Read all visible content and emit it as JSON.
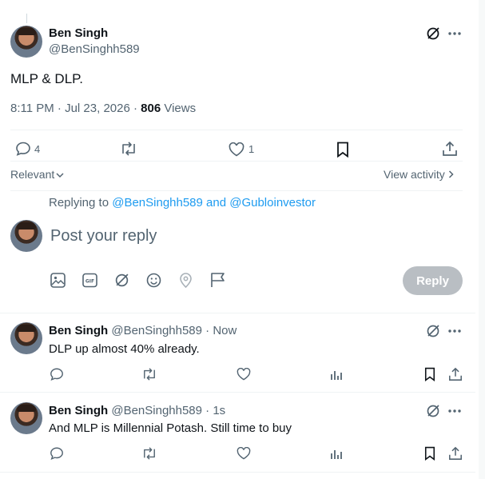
{
  "main_post": {
    "author_name": "Ben Singh",
    "author_handle": "@BenSinghh589",
    "text": "MLP & DLP.",
    "time": "8:11 PM · Jul 23, 2026 ·",
    "views_count": "806",
    "views_label": "Views",
    "reply_count": "4",
    "like_count": "1"
  },
  "filters": {
    "sort_label": "Relevant",
    "view_activity_label": "View activity"
  },
  "composer": {
    "replying_to_prefix": "Replying to",
    "replying_to_users": "@BenSinghh589 and @Gubloinvestor",
    "placeholder": "Post your reply",
    "reply_button": "Reply"
  },
  "replies": [
    {
      "author_name": "Ben Singh",
      "meta": "@BenSinghh589 · Now",
      "text": "DLP up almost 40% already."
    },
    {
      "author_name": "Ben Singh",
      "meta": "@BenSinghh589 · 1s",
      "text": "And MLP is Millennial Potash. Still time to buy"
    }
  ],
  "colors": {
    "accent": "#1d9bf0",
    "muted": "#536471",
    "reply_button_disabled": "#b9bec3"
  }
}
